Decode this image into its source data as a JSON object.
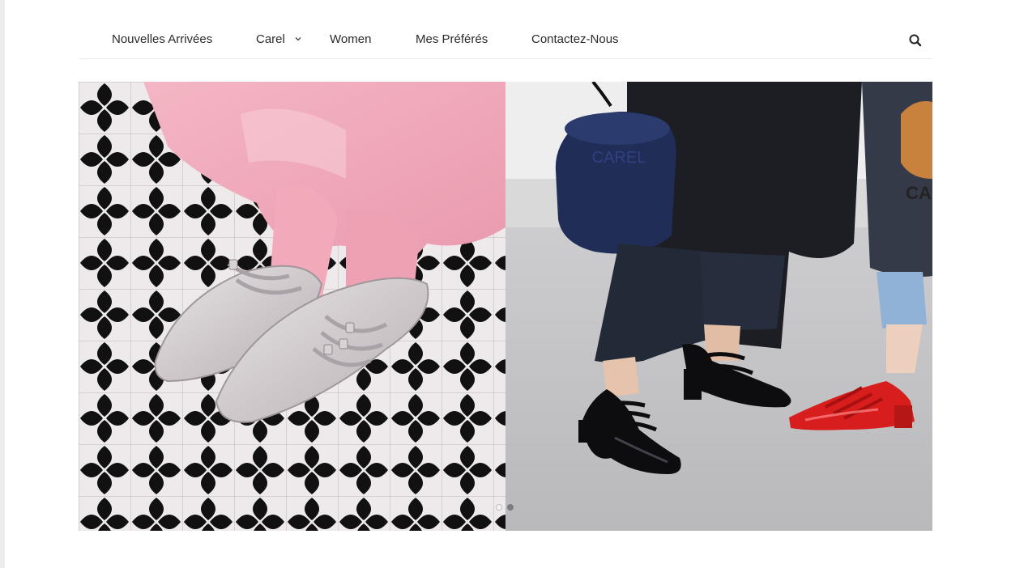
{
  "nav": {
    "items": [
      {
        "label": "Nouvelles Arrivées"
      },
      {
        "label": "Carel"
      },
      {
        "label": "Women"
      },
      {
        "label": "Mes Préférés"
      },
      {
        "label": "Contactez-Nous"
      }
    ],
    "dropdown_icon": "chevron-down-icon",
    "search_icon": "search-icon"
  },
  "hero": {
    "slides": [
      {
        "description_icon": "photo-silver-mary-jane-shoes"
      },
      {
        "description_icon": "photo-street-style-mary-jane-heels"
      }
    ],
    "bag_lettering": "CAREL",
    "active_slide": 2,
    "slide_count": 2
  },
  "colors": {
    "text": "#2a2a2a",
    "divider": "#ececec",
    "pink": "#f0a6b8",
    "silver": "#cfc9cc",
    "red_shoe": "#d81d1d",
    "navy_bag": "#1f2d57",
    "tan_bag": "#c8823e"
  }
}
